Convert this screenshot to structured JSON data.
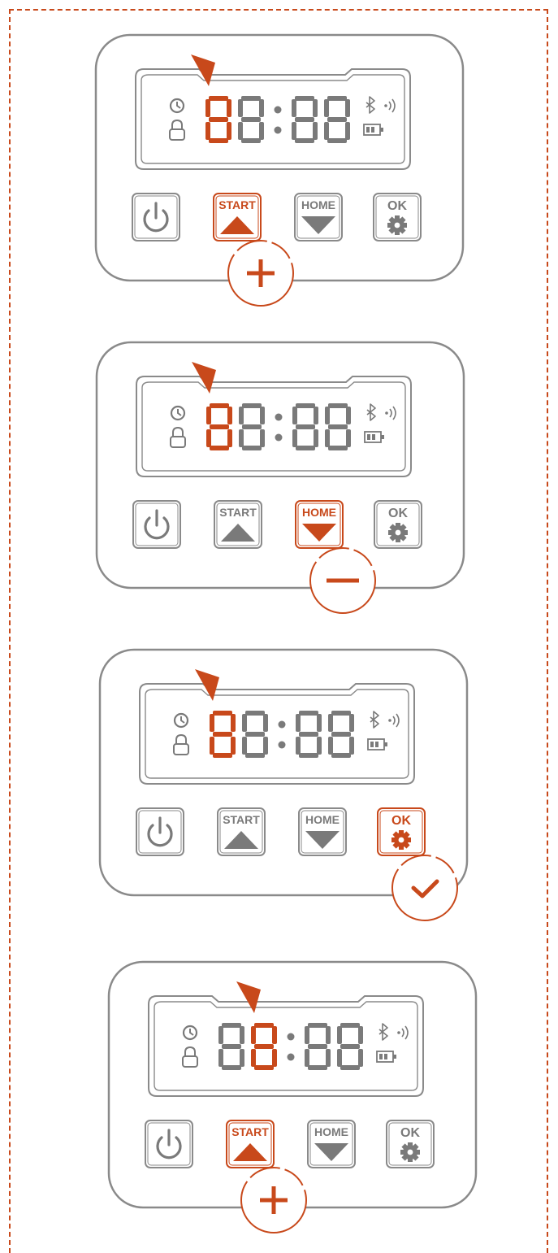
{
  "colors": {
    "accent": "#C8491B",
    "inactive": "#7A7A7A",
    "outline": "#8A8A8A",
    "frame": "#C8491B"
  },
  "icons": {
    "power": "power-icon",
    "clock": "clock-icon",
    "lock": "lock-icon",
    "bluetooth": "bluetooth-icon",
    "signal": "signal-waves-icon",
    "battery": "battery-icon",
    "settings": "gear-icon",
    "pointer": "pointer-triangle-icon"
  },
  "display": {
    "digits": [
      "8",
      "8",
      "8",
      "8"
    ]
  },
  "buttons": {
    "start_label": "START",
    "home_label": "HOME",
    "ok_label": "OK"
  },
  "steps": [
    {
      "active_button": "start",
      "badge": "plus",
      "highlighted_digit": 0
    },
    {
      "active_button": "home",
      "badge": "minus",
      "highlighted_digit": 0
    },
    {
      "active_button": "ok",
      "badge": "check",
      "highlighted_digit": 0
    },
    {
      "active_button": "start",
      "badge": "plus",
      "highlighted_digit": 1
    }
  ]
}
